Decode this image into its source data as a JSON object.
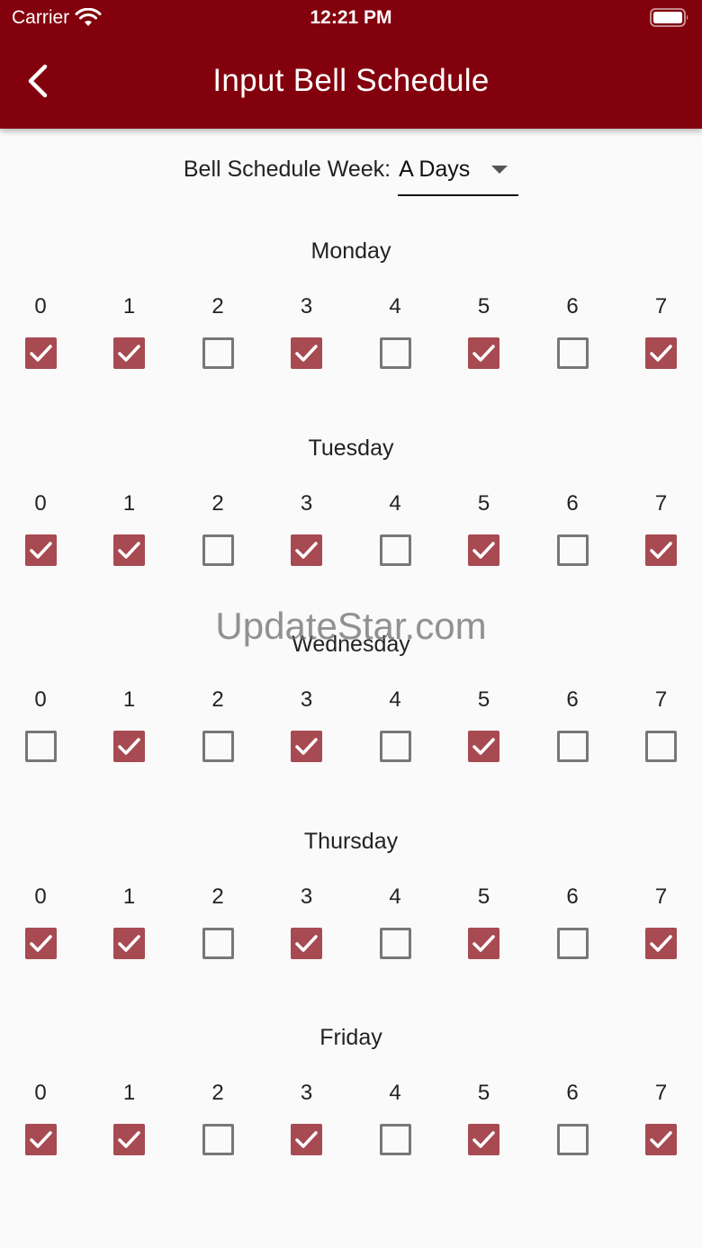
{
  "status_bar": {
    "carrier": "Carrier",
    "time": "12:21 PM",
    "icons": [
      "wifi-icon",
      "battery-icon"
    ]
  },
  "header": {
    "title": "Input Bell Schedule",
    "back_icon": "chevron-left-icon",
    "background_color": "#83000d"
  },
  "week_selector": {
    "label": "Bell Schedule Week:",
    "value": "A Days",
    "arrow_icon": "caret-down-icon"
  },
  "colors": {
    "checked": "#a74a52",
    "unchecked_border": "#777777",
    "background": "#fafafa"
  },
  "periods": [
    "0",
    "1",
    "2",
    "3",
    "4",
    "5",
    "6",
    "7"
  ],
  "days": [
    {
      "name": "Monday",
      "checked": [
        true,
        true,
        false,
        true,
        false,
        true,
        false,
        true
      ]
    },
    {
      "name": "Tuesday",
      "checked": [
        true,
        true,
        false,
        true,
        false,
        true,
        false,
        true
      ]
    },
    {
      "name": "Wednesday",
      "checked": [
        false,
        true,
        false,
        true,
        false,
        true,
        false,
        false
      ]
    },
    {
      "name": "Thursday",
      "checked": [
        true,
        true,
        false,
        true,
        false,
        true,
        false,
        true
      ]
    },
    {
      "name": "Friday",
      "checked": [
        true,
        true,
        false,
        true,
        false,
        true,
        false,
        true
      ]
    }
  ],
  "watermark": "UpdateStar.com"
}
